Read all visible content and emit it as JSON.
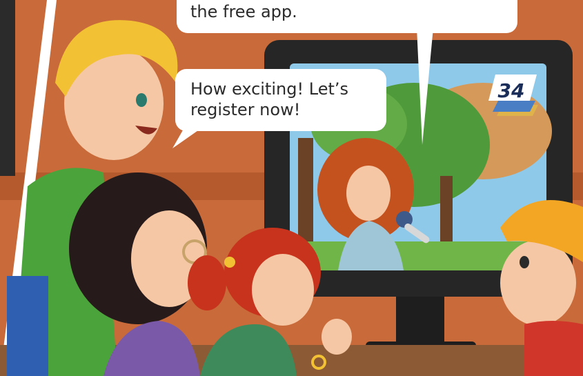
{
  "speech": {
    "top_bubble": "the free app.",
    "middle_bubble": "How exciting! Let’s\nregister now!"
  },
  "tv": {
    "channel_badge": "34"
  },
  "colors": {
    "wall": "#c96a3a",
    "wall_stripe": "#b45a2d",
    "tv_frame": "#262626",
    "bubble": "#ffffff",
    "sky": "#8fc9ea",
    "tree": "#4f9a3a",
    "badge": "#1b2e59"
  }
}
